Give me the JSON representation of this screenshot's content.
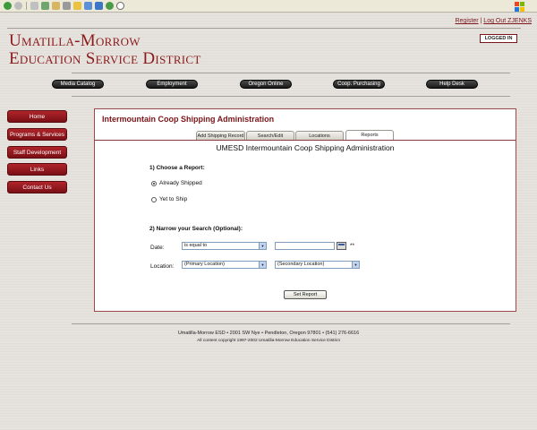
{
  "header": {
    "register_link": "Register",
    "separator": "|",
    "logout_link": "Log Out ZJENKS",
    "logged_in_badge": "LOGGED IN",
    "org_line1": "Umatilla-Morrow",
    "org_line2": "Education Service District"
  },
  "top_nav": [
    "Media Catalog",
    "Employment",
    "Oregon Online",
    "Coop. Purchasing",
    "Help Desk"
  ],
  "side_nav": [
    "Home",
    "Programs & Services",
    "Staff Development",
    "Links",
    "Contact Us"
  ],
  "panel": {
    "title": "Intermountain Coop Shipping Administration",
    "tabs": [
      "Add Shipping Record",
      "Search/Edit",
      "Locations",
      "Reports"
    ],
    "active_tab": "Reports",
    "subtitle": "UMESD Intermountain Coop Shipping Administration"
  },
  "report_form": {
    "choose_heading": "1) Choose a Report:",
    "option_shipped": "Already Shipped",
    "option_yet": "Yet to Ship",
    "selected_option": "Already Shipped",
    "narrow_heading": "2) Narrow your Search (Optional):",
    "date_label": "Date:",
    "date_operator": "is equal to",
    "date_value": "",
    "date_suffix": "**",
    "location_label": "Location:",
    "primary_location": "(Primary Location)",
    "secondary_location": "(Secondary Location)",
    "submit_label": "Set Report"
  },
  "footer": {
    "address": "Umatilla-Morrow ESD • 2001 SW Nye • Pendleton, Oregon 97801 • (541) 276-6616",
    "copyright": "All content copyright 1997-2002 Umatilla-Morrow Education Service District"
  }
}
